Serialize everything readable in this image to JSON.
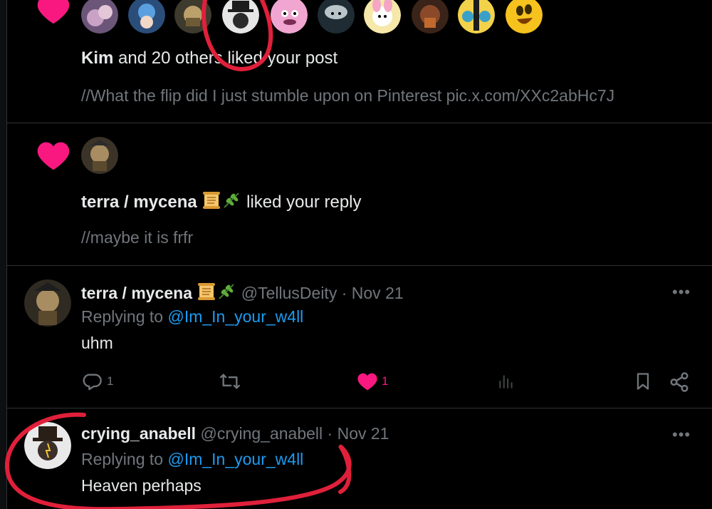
{
  "colors": {
    "background": "#000000",
    "divider": "#2f3336",
    "like_pink": "#f91880",
    "link_blue": "#1d9bf0",
    "muted": "#71767b",
    "annotation_red": "#e0203a"
  },
  "notification_1": {
    "icon": "heart-icon",
    "liker_avatar_count": 10,
    "actor_name": "Kim",
    "action_text": "and 20 others liked your post",
    "quoted_text": "//What the flip did I just stumble upon on Pinterest pic.x.com/XXc2abHc7J"
  },
  "notification_2": {
    "icon": "heart-icon",
    "actor_name": "terra / mycena",
    "actor_emojis": [
      "scroll-emoji",
      "herb-emoji"
    ],
    "action_text": "liked your reply",
    "quoted_text": "//maybe it is frfr"
  },
  "reply_1": {
    "display_name": "terra / mycena",
    "name_emojis": [
      "scroll-emoji",
      "herb-emoji"
    ],
    "handle": "@TellusDeity",
    "separator": "·",
    "date": "Nov 21",
    "replying_label": "Replying to",
    "replying_handle": "@Im_In_your_w4ll",
    "text": "uhm",
    "more_label": "•••",
    "actions": {
      "reply_count": "1",
      "like_count": "1",
      "liked": true
    }
  },
  "reply_2": {
    "display_name": "crying_anabell",
    "handle": "@crying_anabell",
    "separator": "·",
    "date": "Nov 21",
    "replying_label": "Replying to",
    "replying_handle": "@Im_In_your_w4ll",
    "text": "Heaven perhaps",
    "more_label": "•••"
  }
}
